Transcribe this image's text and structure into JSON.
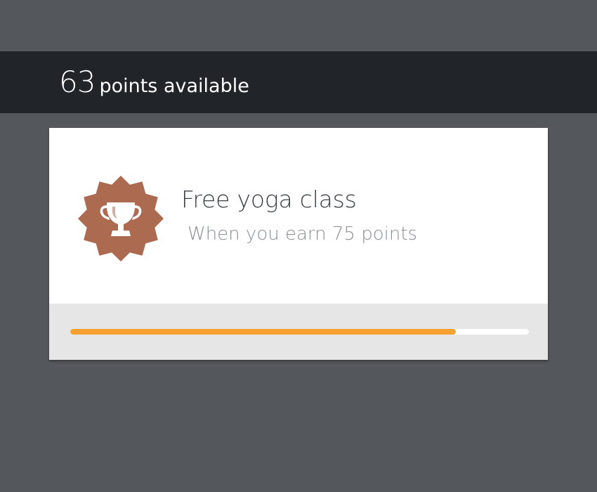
{
  "header": {
    "points": "63",
    "points_label": "points available"
  },
  "reward": {
    "title": "Free yoga class",
    "subtitle": "When you earn 75 points",
    "icon": "trophy-badge-icon",
    "badge_color": "#ac6a50",
    "progress": 0.84
  },
  "colors": {
    "background": "#54575b",
    "header_bar": "#212429",
    "progress_fill": "#f9a130",
    "progress_track": "#ffffff",
    "card_footer": "#e6e6e6"
  }
}
